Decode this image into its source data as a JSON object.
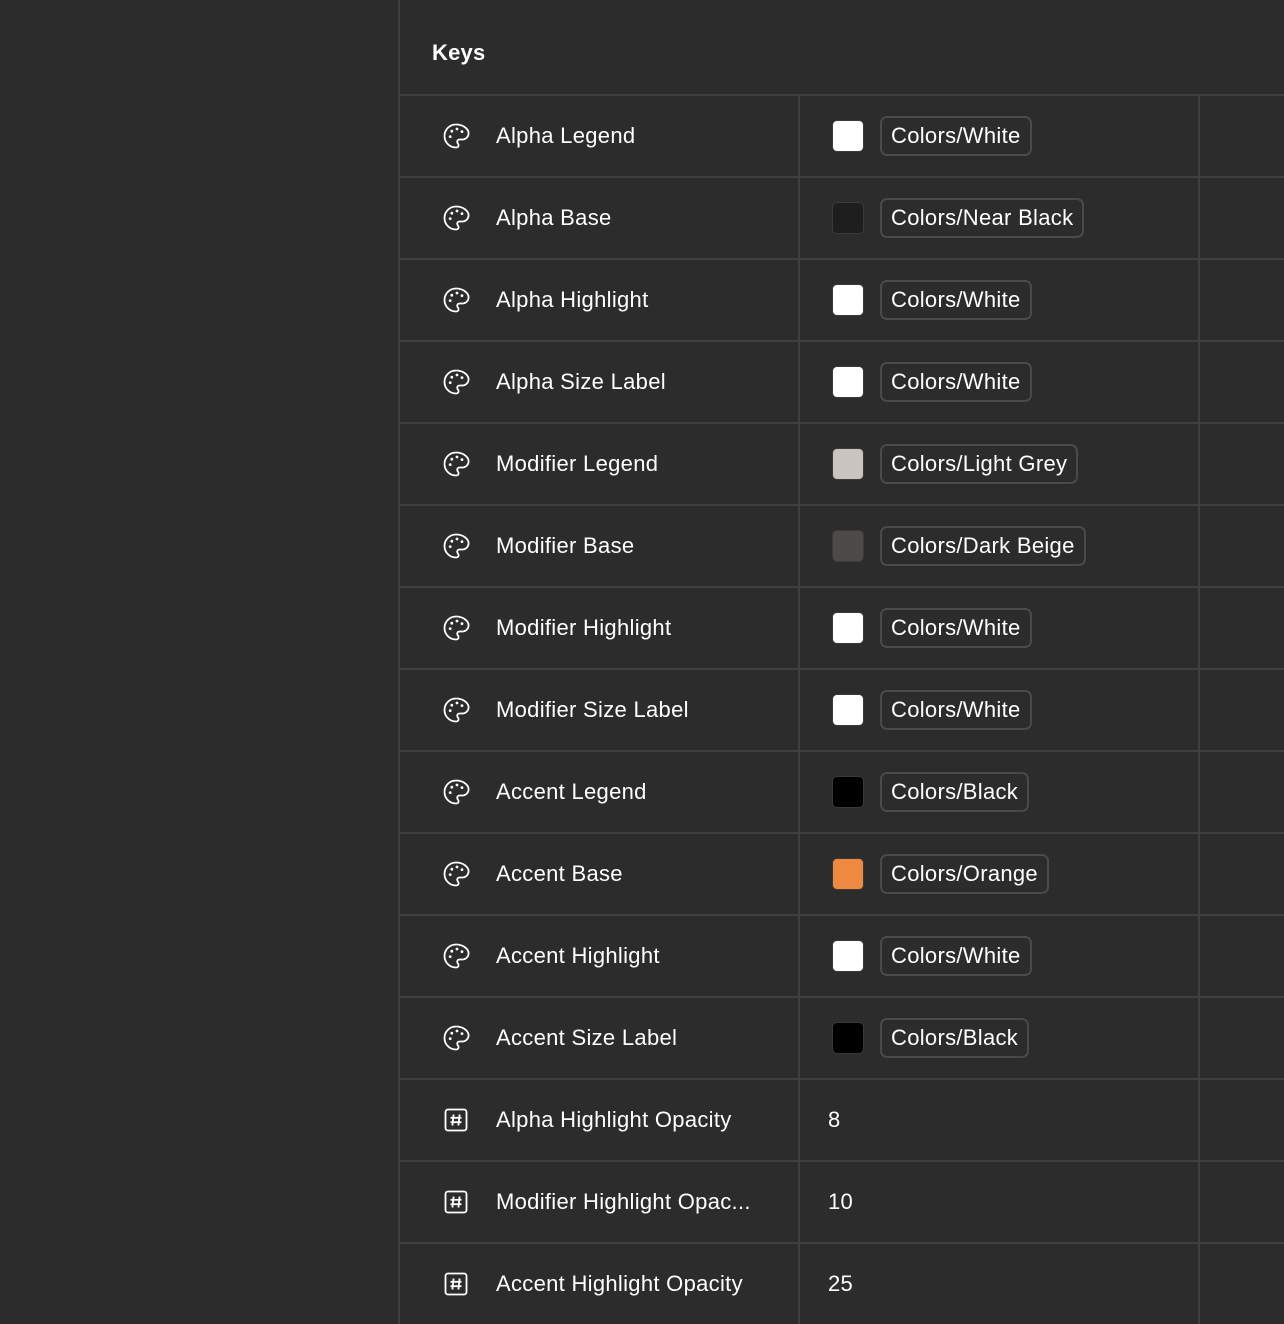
{
  "header": {
    "title": "Keys"
  },
  "colors": {
    "Colors/White": "#ffffff",
    "Colors/Near Black": "#1e1e1e",
    "Colors/Light Grey": "#c9c4bf",
    "Colors/Dark Beige": "#4d4a48",
    "Colors/Black": "#000000",
    "Colors/Orange": "#ee8a40"
  },
  "rows": [
    {
      "icon": "palette-icon",
      "name": "Alpha Legend",
      "type": "color",
      "token": "Colors/White"
    },
    {
      "icon": "palette-icon",
      "name": "Alpha Base",
      "type": "color",
      "token": "Colors/Near Black"
    },
    {
      "icon": "palette-icon",
      "name": "Alpha Highlight",
      "type": "color",
      "token": "Colors/White"
    },
    {
      "icon": "palette-icon",
      "name": "Alpha Size Label",
      "type": "color",
      "token": "Colors/White"
    },
    {
      "icon": "palette-icon",
      "name": "Modifier Legend",
      "type": "color",
      "token": "Colors/Light Grey"
    },
    {
      "icon": "palette-icon",
      "name": "Modifier Base",
      "type": "color",
      "token": "Colors/Dark Beige"
    },
    {
      "icon": "palette-icon",
      "name": "Modifier Highlight",
      "type": "color",
      "token": "Colors/White"
    },
    {
      "icon": "palette-icon",
      "name": "Modifier Size Label",
      "type": "color",
      "token": "Colors/White"
    },
    {
      "icon": "palette-icon",
      "name": "Accent Legend",
      "type": "color",
      "token": "Colors/Black"
    },
    {
      "icon": "palette-icon",
      "name": "Accent Base",
      "type": "color",
      "token": "Colors/Orange"
    },
    {
      "icon": "palette-icon",
      "name": "Accent Highlight",
      "type": "color",
      "token": "Colors/White"
    },
    {
      "icon": "palette-icon",
      "name": "Accent Size Label",
      "type": "color",
      "token": "Colors/Black"
    },
    {
      "icon": "hash-icon",
      "name": "Alpha Highlight Opacity",
      "type": "number",
      "value": "8"
    },
    {
      "icon": "hash-icon",
      "name": "Modifier Highlight Opac...",
      "type": "number",
      "value": "10"
    },
    {
      "icon": "hash-icon",
      "name": "Accent Highlight Opacity",
      "type": "number",
      "value": "25"
    }
  ]
}
